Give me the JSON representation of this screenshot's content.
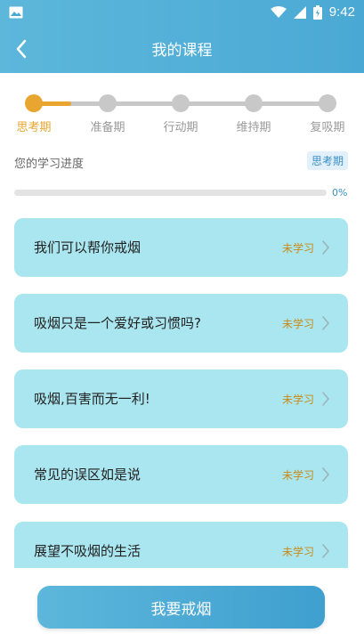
{
  "statusbar": {
    "time": "9:42"
  },
  "header": {
    "title": "我的课程"
  },
  "stages": [
    {
      "label": "思考期",
      "active": true
    },
    {
      "label": "准备期",
      "active": false
    },
    {
      "label": "行动期",
      "active": false
    },
    {
      "label": "维持期",
      "active": false
    },
    {
      "label": "复吸期",
      "active": false
    }
  ],
  "progress": {
    "label": "您的学习进度",
    "current_stage": "思考期",
    "percent_text": "0%",
    "fraction": 0
  },
  "lessons": [
    {
      "title": "我们可以帮你戒烟",
      "status": "未学习"
    },
    {
      "title": "吸烟只是一个爱好或习惯吗?",
      "status": "未学习"
    },
    {
      "title": "吸烟,百害而无一利!",
      "status": "未学习"
    },
    {
      "title": "常见的误区如是说",
      "status": "未学习"
    },
    {
      "title": "展望不吸烟的生活",
      "status": "未学习"
    }
  ],
  "cta": {
    "label": "我要戒烟"
  },
  "colors": {
    "accent": "#4aa9d4",
    "active_stage": "#e8a630",
    "card": "#a9e6ef"
  },
  "icons": {
    "back": "chevron-left-icon",
    "chevron": "chevron-right-icon",
    "wifi": "wifi-icon",
    "signal": "signal-icon",
    "battery": "battery-icon",
    "notification": "image-icon"
  }
}
